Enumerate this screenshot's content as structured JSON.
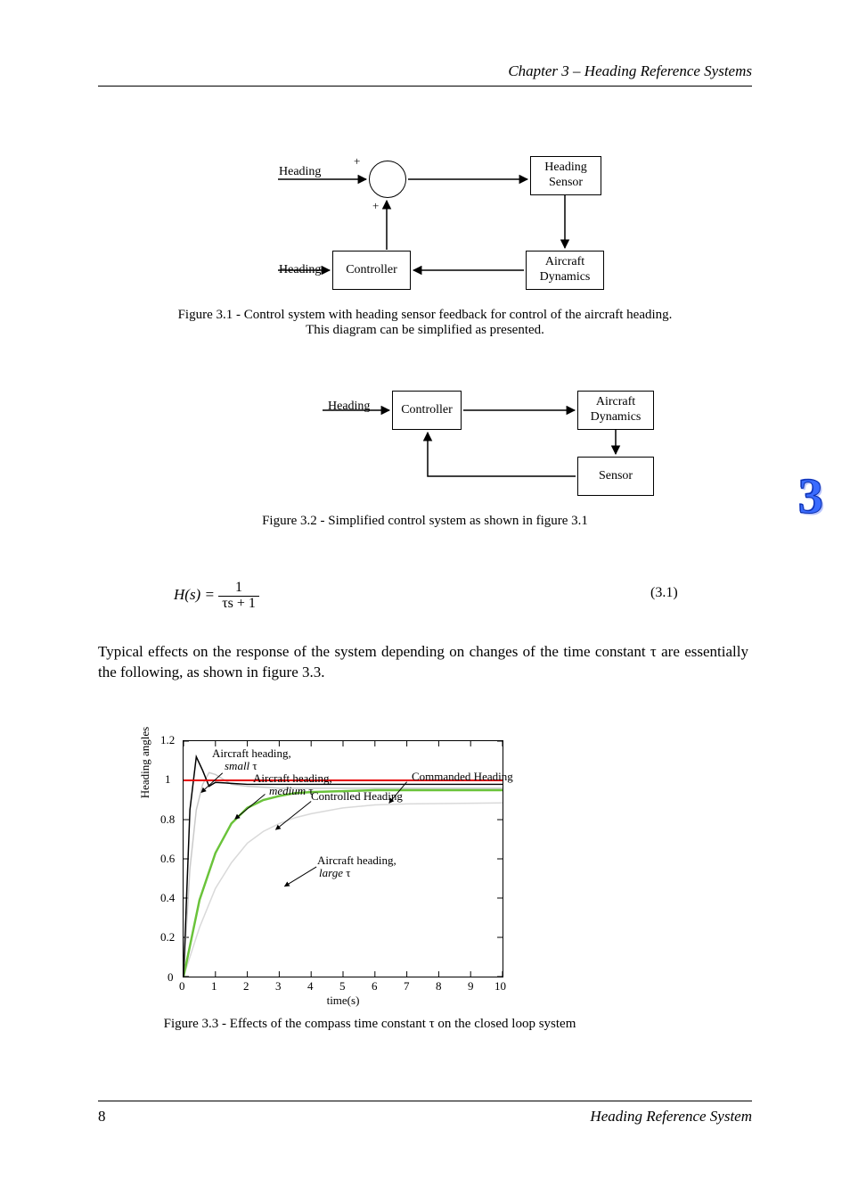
{
  "header": {
    "section_title": "Chapter 3 – Heading Reference Systems"
  },
  "figure1": {
    "input1": "Heading",
    "input2": "Heading",
    "blocks": {
      "compass": "Heading\nSensor",
      "aircraft": "Aircraft\nDynamics",
      "controller": "Controller"
    },
    "plus1": "+",
    "plus2": "+",
    "caption_line1": "Figure 3.1 - Control system with heading sensor feedback for control of the aircraft heading.",
    "caption_line2": "This diagram can be simplified as presented."
  },
  "figure2": {
    "input": "Heading",
    "blocks": {
      "controller": "Controller",
      "aircraft": "Aircraft\nDynamics",
      "sensor": "Sensor"
    },
    "caption": "Figure 3.2 - Simplified control system as shown in figure 3.1"
  },
  "equation": {
    "label": "H(s) =",
    "num": "1",
    "den": "τs + 1",
    "number": "(3.1)"
  },
  "paragraph": "Typical effects on the response of the system depending on changes of the time constant τ are essentially the following, as shown in figure 3.3.",
  "figure3": {
    "ylabel": "Heading angles",
    "xlabel": "time(s)",
    "caption": "Figure 3.3 - Effects of the compass time constant τ on the closed loop system"
  },
  "chart_data": {
    "type": "line",
    "title": "",
    "xlabel": "time(s)",
    "ylabel": "Heading angles",
    "xlim": [
      0,
      10
    ],
    "ylim": [
      0,
      1.2
    ],
    "categories": [
      0,
      1,
      2,
      3,
      4,
      5,
      6,
      7,
      8,
      9,
      10
    ],
    "yticks": [
      0,
      0.2,
      0.4,
      0.6,
      0.8,
      1.0,
      1.2
    ],
    "series": [
      {
        "name": "Commanded Heading",
        "color": "#e60000",
        "x": [
          0,
          10
        ],
        "y": [
          1.0,
          1.0
        ]
      },
      {
        "name": "Aircraft heading, small τ",
        "color": "#000000",
        "x": [
          0,
          0.2,
          0.4,
          0.6,
          0.8,
          1.0,
          1.5,
          2.0,
          3.0,
          10
        ],
        "y": [
          0,
          0.85,
          1.12,
          1.05,
          0.97,
          0.99,
          0.985,
          0.98,
          0.98,
          0.98
        ]
      },
      {
        "name": "Aircraft heading, medium τ",
        "color": "#c9c9c9",
        "x": [
          0,
          0.2,
          0.4,
          0.6,
          0.8,
          1.0,
          1.5,
          2.0,
          3.0,
          4.0,
          10
        ],
        "y": [
          0,
          0.55,
          0.85,
          0.98,
          1.04,
          1.03,
          0.98,
          0.97,
          0.96,
          0.96,
          0.96
        ]
      },
      {
        "name": "Controlled Heading",
        "color": "#6ac33a",
        "x": [
          0,
          0.5,
          1.0,
          1.5,
          2.0,
          2.5,
          3.0,
          3.5,
          4.0,
          5.0,
          6.0,
          10
        ],
        "y": [
          0,
          0.39,
          0.63,
          0.78,
          0.86,
          0.9,
          0.92,
          0.935,
          0.94,
          0.945,
          0.95,
          0.95
        ]
      },
      {
        "name": "Aircraft heading, large τ",
        "color": "#d9d9d9",
        "x": [
          0,
          0.5,
          1.0,
          1.5,
          2.0,
          2.5,
          3.0,
          3.5,
          4.0,
          5.0,
          6.0,
          7.0,
          10
        ],
        "y": [
          0,
          0.25,
          0.45,
          0.58,
          0.68,
          0.74,
          0.78,
          0.81,
          0.83,
          0.86,
          0.875,
          0.88,
          0.885
        ]
      }
    ],
    "annotations": [
      {
        "text": "Commanded Heading",
        "approx_xy": [
          7.5,
          1.05
        ]
      },
      {
        "text": "Aircraft heading, small τ",
        "approx_xy": [
          2.0,
          1.18
        ]
      },
      {
        "text": "Aircraft heading, medium τ",
        "approx_xy": [
          3.0,
          1.1
        ]
      },
      {
        "text": "Controlled Heading",
        "approx_xy": [
          4.5,
          1.0
        ]
      },
      {
        "text": "Aircraft heading, large τ",
        "approx_xy": [
          5.0,
          0.72
        ]
      }
    ]
  },
  "chart_labels": {
    "cmd": "Commanded Heading",
    "small": "Aircraft heading,",
    "small2": "small τ",
    "medium": "Aircraft heading,",
    "medium2": "medium τ",
    "controlled": "Controlled Heading",
    "large": "Aircraft heading,",
    "large2": "large τ"
  },
  "footer": {
    "page_number": "8",
    "project": "Heading Reference System"
  },
  "badge": "3"
}
